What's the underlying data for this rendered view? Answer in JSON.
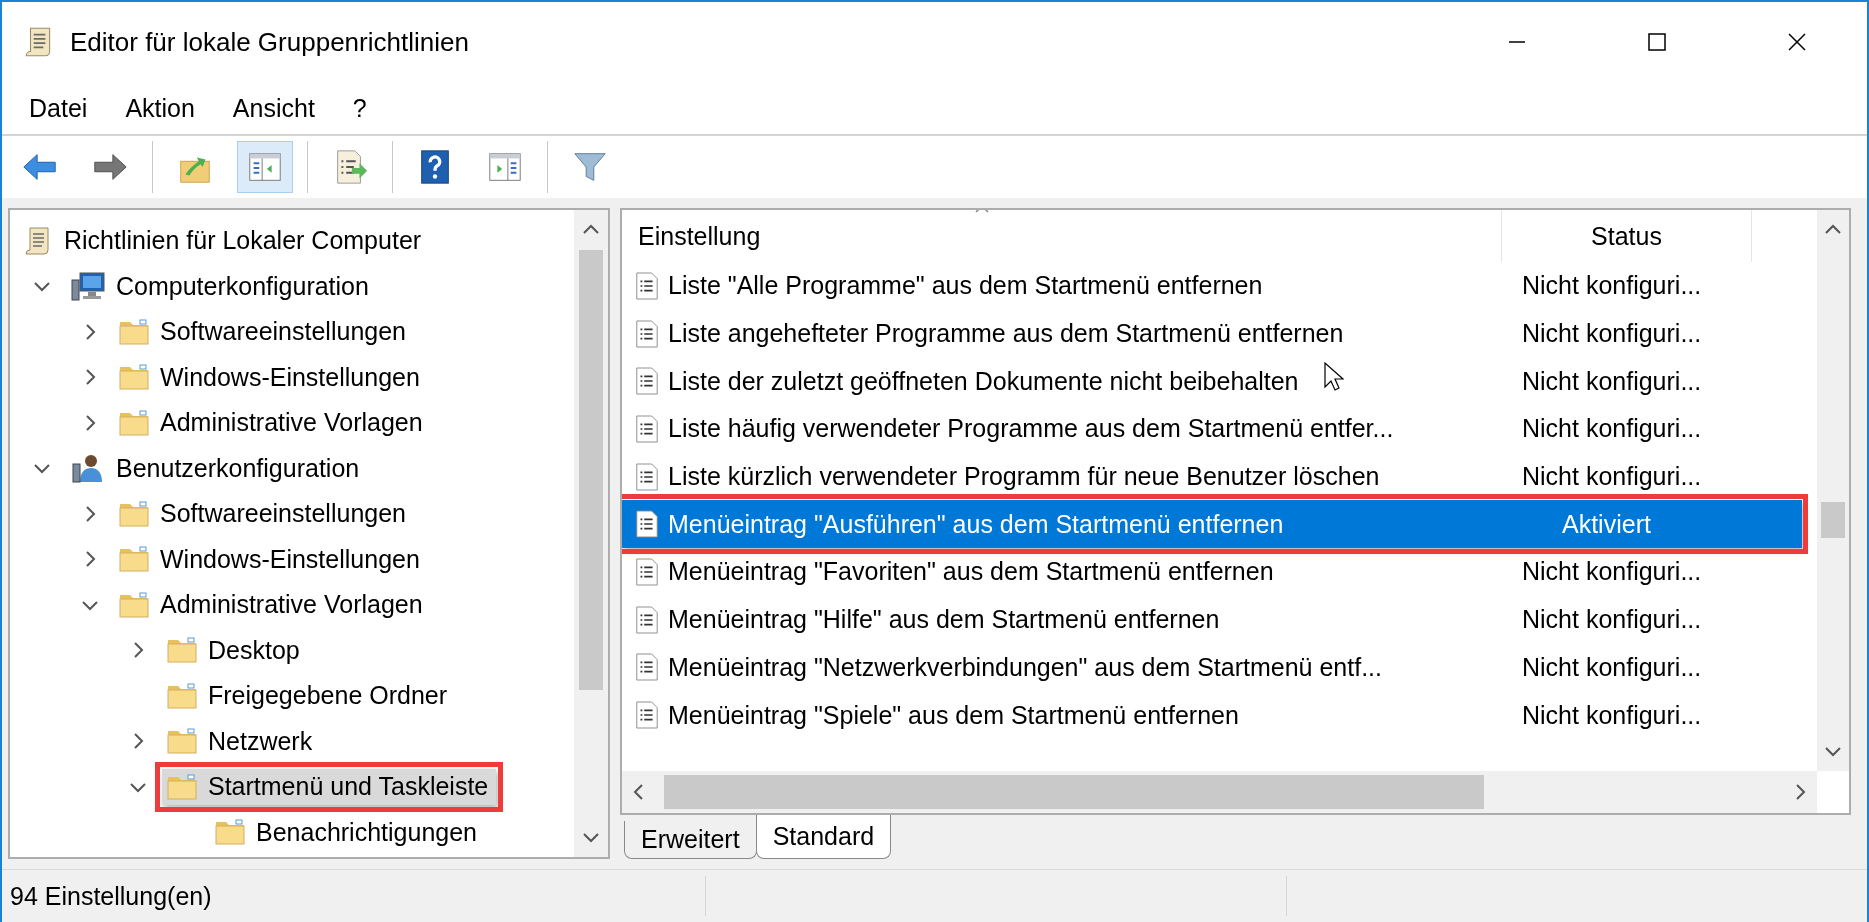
{
  "window": {
    "title": "Editor für lokale Gruppenrichtlinien"
  },
  "menu": [
    "Datei",
    "Aktion",
    "Ansicht",
    "?"
  ],
  "toolbar": [
    [
      {
        "kind": "back",
        "disabled": false,
        "pressed": false
      },
      {
        "kind": "forward",
        "disabled": true,
        "pressed": false
      }
    ],
    [
      {
        "kind": "up",
        "disabled": false,
        "pressed": false
      },
      {
        "kind": "tree",
        "disabled": false,
        "pressed": true
      }
    ],
    [
      {
        "kind": "export",
        "disabled": false,
        "pressed": false
      }
    ],
    [
      {
        "kind": "help",
        "disabled": false,
        "pressed": false
      },
      {
        "kind": "actionpane",
        "disabled": false,
        "pressed": false
      }
    ],
    [
      {
        "kind": "filter",
        "disabled": false,
        "pressed": false
      }
    ]
  ],
  "tree": {
    "items": [
      {
        "label": "Richtlinien für Lokaler Computer",
        "kind": "policy",
        "selected": false,
        "marked": false,
        "children": [
          {
            "label": "Computerkonfiguration",
            "kind": "computer",
            "expanded": true,
            "selected": false,
            "marked": false,
            "children": [
              {
                "label": "Softwareeinstellungen",
                "kind": "folder",
                "expanded": false,
                "selected": false,
                "marked": false
              },
              {
                "label": "Windows-Einstellungen",
                "kind": "folder",
                "expanded": false,
                "selected": false,
                "marked": false
              },
              {
                "label": "Administrative Vorlagen",
                "kind": "folder",
                "expanded": false,
                "selected": false,
                "marked": false
              }
            ]
          },
          {
            "label": "Benutzerkonfiguration",
            "kind": "user",
            "expanded": true,
            "selected": false,
            "marked": false,
            "children": [
              {
                "label": "Softwareeinstellungen",
                "kind": "folder",
                "expanded": false,
                "selected": false,
                "marked": false
              },
              {
                "label": "Windows-Einstellungen",
                "kind": "folder",
                "expanded": false,
                "selected": false,
                "marked": false
              },
              {
                "label": "Administrative Vorlagen",
                "kind": "folder",
                "expanded": true,
                "selected": false,
                "marked": false,
                "children": [
                  {
                    "label": "Desktop",
                    "kind": "folder",
                    "expanded": false,
                    "selected": false,
                    "marked": false
                  },
                  {
                    "label": "Freigegebene Ordner",
                    "kind": "folder",
                    "selected": false,
                    "marked": false
                  },
                  {
                    "label": "Netzwerk",
                    "kind": "folder",
                    "expanded": false,
                    "selected": false,
                    "marked": false
                  },
                  {
                    "label": "Startmenü und Taskleiste",
                    "kind": "folder",
                    "expanded": true,
                    "selected": true,
                    "marked": true,
                    "children": [
                      {
                        "label": "Benachrichtigungen",
                        "kind": "folder",
                        "selected": false,
                        "marked": false
                      }
                    ]
                  }
                ]
              }
            ]
          }
        ]
      }
    ]
  },
  "table": {
    "columns": [
      {
        "label": "Einstellung"
      },
      {
        "label": "Status"
      }
    ],
    "rows": [
      {
        "setting": "Liste \"Alle Programme\" aus dem Startmenü entfernen",
        "status": "Nicht konfiguri...",
        "selected": false,
        "marked": false
      },
      {
        "setting": "Liste angehefteter Programme aus dem Startmenü entfernen",
        "status": "Nicht konfiguri...",
        "selected": false,
        "marked": false
      },
      {
        "setting": "Liste der zuletzt geöffneten Dokumente nicht beibehalten",
        "status": "Nicht konfiguri...",
        "selected": false,
        "marked": false
      },
      {
        "setting": "Liste häufig verwendeter Programme aus dem Startmenü entfer...",
        "status": "Nicht konfiguri...",
        "selected": false,
        "marked": false
      },
      {
        "setting": "Liste kürzlich verwendeter Programm für neue Benutzer löschen",
        "status": "Nicht konfiguri...",
        "selected": false,
        "marked": false
      },
      {
        "setting": "Menüeintrag \"Ausführen\" aus dem Startmenü entfernen",
        "status": "Aktiviert",
        "selected": true,
        "marked": true
      },
      {
        "setting": "Menüeintrag \"Favoriten\" aus dem Startmenü entfernen",
        "status": "Nicht konfiguri...",
        "selected": false,
        "marked": false
      },
      {
        "setting": "Menüeintrag \"Hilfe\" aus dem Startmenü entfernen",
        "status": "Nicht konfiguri...",
        "selected": false,
        "marked": false
      },
      {
        "setting": "Menüeintrag \"Netzwerkverbindungen\" aus dem Startmenü entf...",
        "status": "Nicht konfiguri...",
        "selected": false,
        "marked": false
      },
      {
        "setting": "Menüeintrag \"Spiele\" aus dem Startmenü entfernen",
        "status": "Nicht konfiguri...",
        "selected": false,
        "marked": false
      }
    ]
  },
  "tabs": [
    {
      "label": "Erweitert",
      "selected": false
    },
    {
      "label": "Standard",
      "selected": true
    }
  ],
  "status_bar": {
    "text": "94 Einstellung(en)"
  }
}
